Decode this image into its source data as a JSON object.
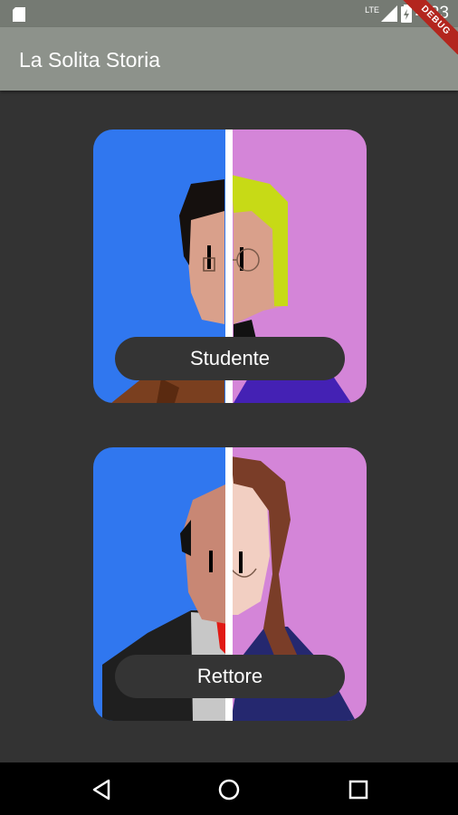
{
  "status_bar": {
    "time": "4:23",
    "network_label": "LTE",
    "icons": [
      "sd-card-icon",
      "signal-icon",
      "battery-icon"
    ]
  },
  "app_bar": {
    "title": "La Solita Storia",
    "debug_banner": "DEBUG"
  },
  "cards": [
    {
      "label": "Studente"
    },
    {
      "label": "Rettore"
    }
  ],
  "nav_bar": {
    "icons": [
      "back-icon",
      "home-icon",
      "recents-icon"
    ]
  },
  "colors": {
    "background": "#333333",
    "app_bar": "#8d928b",
    "status_bar": "#757a73",
    "card_left": "#3077ef",
    "card_right": "#d485d8",
    "button": "#343434"
  }
}
